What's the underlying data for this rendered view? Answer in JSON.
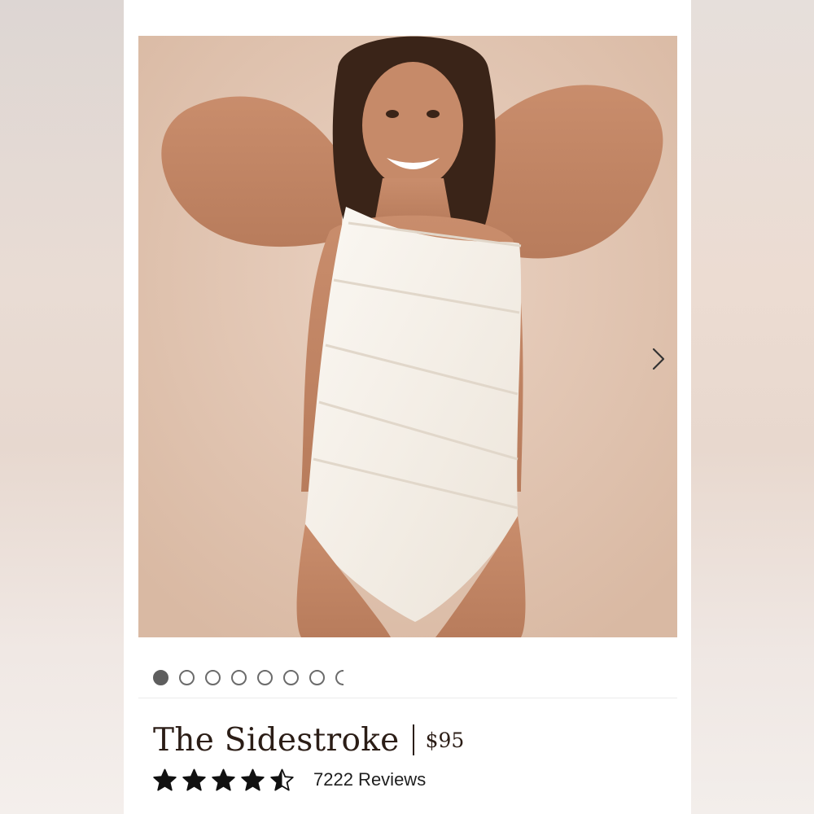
{
  "product": {
    "name": "The Sidestroke",
    "price": "$95",
    "rating": 4.5,
    "rating_max": 5,
    "reviews_label": "7222 Reviews"
  },
  "gallery": {
    "image_count_visible": 8,
    "active_index": 0,
    "next_icon": "chevron-right-icon",
    "photo_description_colors": {
      "backdrop": "#e3c6b3",
      "swimsuit": "#f6f1ea",
      "skin": "#c98d6c",
      "hair": "#3a2418"
    }
  },
  "colors": {
    "text": "#2b1d16",
    "dot_active": "#5e5e5e",
    "dot_border": "#6b6b6b",
    "star": "#111111"
  }
}
